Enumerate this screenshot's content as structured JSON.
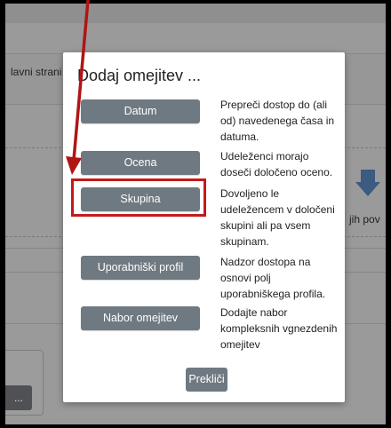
{
  "background": {
    "left_text": "lavni strani",
    "right_text": "jih pov",
    "left_button": "..."
  },
  "dialog": {
    "title": "Dodaj omejitev ...",
    "options": [
      {
        "label": "Datum",
        "description": "Prepreči dostop do (ali od) navedenega časa in datuma."
      },
      {
        "label": "Ocena",
        "description": "Udeleženci morajo doseči določeno oceno."
      },
      {
        "label": "Skupina",
        "description": "Dovoljeno le udeležencem v določeni skupini ali pa vsem skupinam."
      },
      {
        "label": "Uporabniški profil",
        "description": "Nadzor dostopa na osnovi polj uporabniškega profila."
      },
      {
        "label": "Nabor omejitev",
        "description": "Dodajte nabor kompleksnih vgnezdenih omejitev"
      }
    ],
    "cancel_label": "Prekliči"
  },
  "annotation": {
    "highlighted_option": "Skupina",
    "color": "#c21b1b"
  }
}
